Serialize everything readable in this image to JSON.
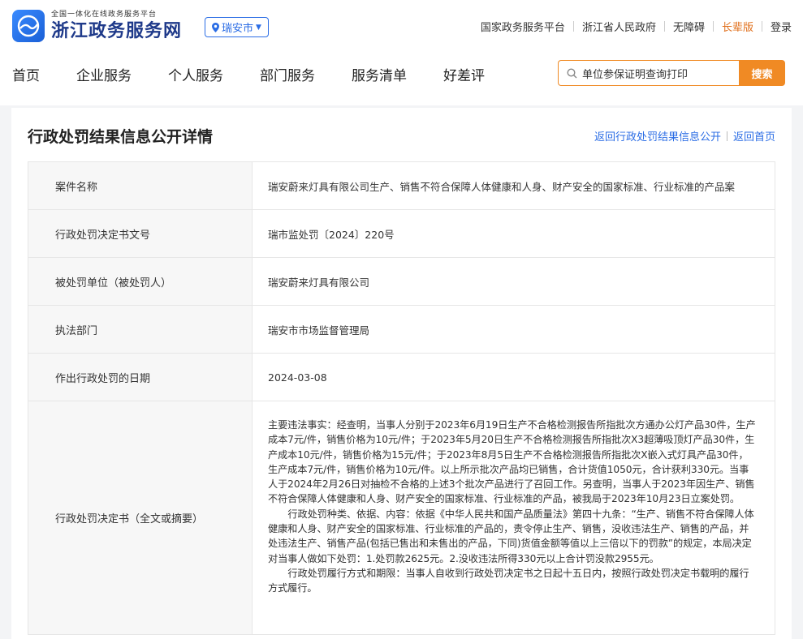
{
  "header": {
    "site_subtitle": "全国一体化在线政务服务平台",
    "site_title": "浙江政务服务网",
    "city": "瑞安市",
    "top_links": [
      "国家政务服务平台",
      "浙江省人民政府",
      "无障碍",
      "长辈版",
      "登录"
    ],
    "nav": [
      "首页",
      "企业服务",
      "个人服务",
      "部门服务",
      "服务清单",
      "好差评"
    ],
    "search": {
      "value": "单位参保证明查询打印",
      "button": "搜索"
    }
  },
  "page": {
    "title": "行政处罚结果信息公开详情",
    "crumb_back": "返回行政处罚结果信息公开",
    "crumb_home": "返回首页"
  },
  "rows": [
    {
      "label": "案件名称",
      "value": "瑞安蔚来灯具有限公司生产、销售不符合保障人体健康和人身、财产安全的国家标准、行业标准的产品案"
    },
    {
      "label": "行政处罚决定书文号",
      "value": "瑞市监处罚〔2024〕220号"
    },
    {
      "label": "被处罚单位（被处罚人）",
      "value": "瑞安蔚来灯具有限公司"
    },
    {
      "label": "执法部门",
      "value": "瑞安市市场监督管理局"
    },
    {
      "label": "作出行政处罚的日期",
      "value": "2024-03-08"
    }
  ],
  "decision": {
    "label": "行政处罚决定书（全文或摘要）",
    "p1": "主要违法事实：经查明，当事人分别于2023年6月19日生产不合格检测报告所指批次方通办公灯产品30件，生产成本7元/件，销售价格为10元/件；于2023年5月20日生产不合格检测报告所指批次X3超薄吸顶灯产品30件，生产成本10元/件，销售价格为15元/件；于2023年8月5日生产不合格检测报告所指批次X嵌入式灯具产品30件，生产成本7元/件，销售价格为10元/件。以上所示批次产品均已销售，合计货值1050元，合计获利330元。当事人于2024年2月26日对抽检不合格的上述3个批次产品进行了召回工作。另查明，当事人于2023年因生产、销售不符合保障人体健康和人身、财产安全的国家标准、行业标准的产品，被我局于2023年10月23日立案处罚。",
    "p2": "行政处罚种类、依据、内容：依据《中华人民共和国产品质量法》第四十九条：“生产、销售不符合保障人体健康和人身、财产安全的国家标准、行业标准的产品的，责令停止生产、销售，没收违法生产、销售的产品，并处违法生产、销售产品(包括已售出和未售出的产品，下同)货值金额等值以上三倍以下的罚款”的规定，本局决定对当事人做如下处罚：1.处罚款2625元。2.没收违法所得330元以上合计罚没款2955元。",
    "p3": "行政处罚履行方式和期限：当事人自收到行政处罚决定书之日起十五日内，按照行政处罚决定书载明的履行方式履行。"
  }
}
